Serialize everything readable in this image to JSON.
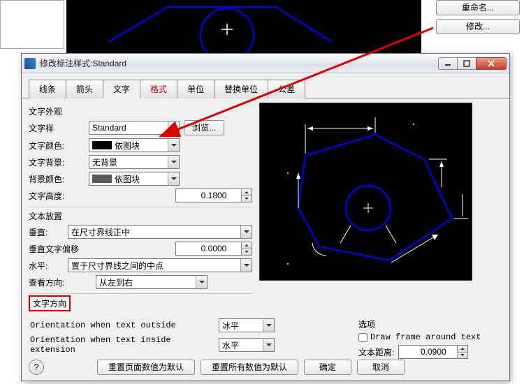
{
  "side_buttons": {
    "rename": "重命名...",
    "modify": "修改..."
  },
  "dialog": {
    "title": "修改标注样式:Standard",
    "tabs": [
      "线条",
      "箭头",
      "文字",
      "格式",
      "单位",
      "替换单位",
      "公差"
    ],
    "active_tab_index": 2
  },
  "appearance": {
    "group": "文字外观",
    "style_label": "文字样",
    "style_value": "Standard",
    "browse": "浏览...",
    "color_label": "文字颜色:",
    "color_value": "依图块",
    "bg_label": "文字背景:",
    "bg_value": "无背景",
    "bgcolor_label": "背景颜色:",
    "bgcolor_value": "依图块",
    "height_label": "文字高度:",
    "height_value": "0.1800"
  },
  "placement": {
    "group": "文本放置",
    "vert_label": "垂直:",
    "vert_value": "在尺寸界线正中",
    "offset_label": "垂直文字偏移",
    "offset_value": "0.0000",
    "horiz_label": "水平:",
    "horiz_value": "置于尺寸界线之间的中点",
    "viewdir_label": "查看方向:",
    "viewdir_value": "从左到右"
  },
  "orientation": {
    "group": "文字方向",
    "outside_label": "Orientation when text outside",
    "outside_value": "冰平",
    "inside_label": "Orientation when text inside extension",
    "inside_value": "水平"
  },
  "options": {
    "group": "选项",
    "drawframe_label": "Draw frame around text",
    "drawframe_checked": false,
    "dist_label": "文本距离:",
    "dist_value": "0.0900"
  },
  "footer": {
    "reset_page": "重置页面数值为默认",
    "reset_all": "重置所有数值为默认",
    "ok": "确定",
    "cancel": "取消",
    "help": "?"
  }
}
